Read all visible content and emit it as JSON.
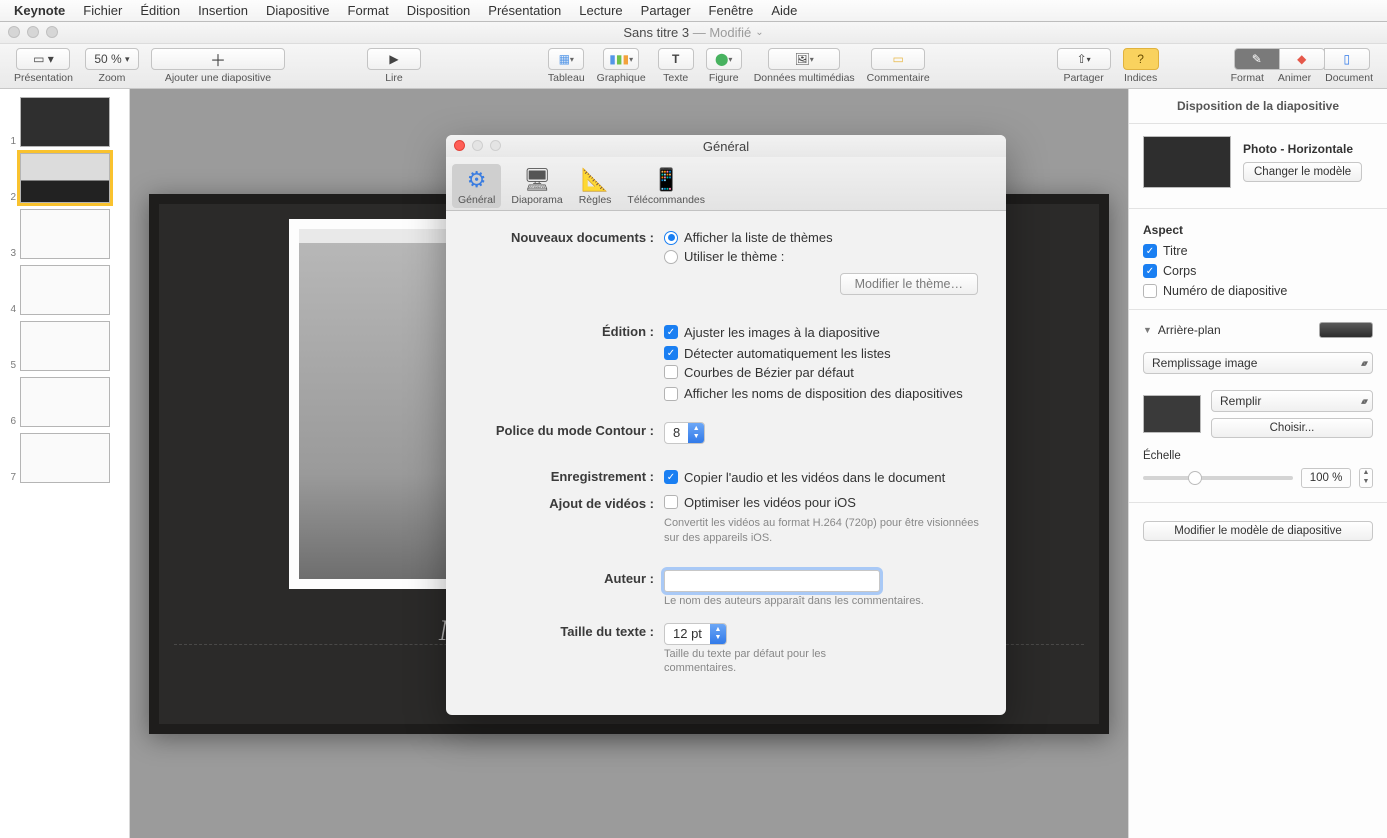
{
  "menubar": {
    "app": "Keynote",
    "items": [
      "Fichier",
      "Édition",
      "Insertion",
      "Diapositive",
      "Format",
      "Disposition",
      "Présentation",
      "Lecture",
      "Partager",
      "Fenêtre",
      "Aide"
    ]
  },
  "titlebar": {
    "title": "Sans titre 3",
    "modified": "— Modifié"
  },
  "toolbar": {
    "presentation": "Présentation",
    "zoom_value": "50 %",
    "zoom": "Zoom",
    "add_slide": "Ajouter une diapositive",
    "play": "Lire",
    "table": "Tableau",
    "chart": "Graphique",
    "text": "Texte",
    "shape": "Figure",
    "media": "Données multimédias",
    "comment": "Commentaire",
    "share": "Partager",
    "tips": "Indices",
    "format": "Format",
    "animate": "Animer",
    "document": "Document"
  },
  "slide_nav": {
    "slides": [
      1,
      2,
      3,
      4,
      5,
      6,
      7
    ],
    "selected": 2
  },
  "slide": {
    "caption": "M"
  },
  "inspector": {
    "title": "Disposition de la diapositive",
    "layout_name": "Photo - Horizontale",
    "change_model": "Changer le modèle",
    "aspect": "Aspect",
    "titre": "Titre",
    "corps": "Corps",
    "slide_number": "Numéro de diapositive",
    "background": "Arrière-plan",
    "fill_type": "Remplissage image",
    "scale_mode": "Remplir",
    "choose": "Choisir...",
    "scale": "Échelle",
    "scale_value": "100 %",
    "edit_model": "Modifier le modèle de diapositive"
  },
  "dialog": {
    "title": "Général",
    "tabs": {
      "general": "Général",
      "slideshow": "Diaporama",
      "rulers": "Règles",
      "remotes": "Télécommandes"
    },
    "new_docs": {
      "label": "Nouveaux documents :",
      "show_theme_list": "Afficher la liste de thèmes",
      "use_theme": "Utiliser le thème :",
      "modify_theme": "Modifier le thème…"
    },
    "editing": {
      "label": "Édition :",
      "fit_images": "Ajuster les images à la diapositive",
      "detect_lists": "Détecter automatiquement les listes",
      "bezier": "Courbes de Bézier par défaut",
      "show_layout_names": "Afficher les noms de disposition des diapositives"
    },
    "outline_font": {
      "label": "Police du mode Contour :",
      "value": "8"
    },
    "recording": {
      "label": "Enregistrement :",
      "copy_av": "Copier l'audio et les vidéos dans le document"
    },
    "adding_videos": {
      "label": "Ajout de vidéos :",
      "optimize": "Optimiser les vidéos pour iOS",
      "help": "Convertit les vidéos au format H.264 (720p) pour être visionnées sur des appareils iOS."
    },
    "author": {
      "label": "Auteur :",
      "value": "",
      "help": "Le nom des auteurs apparaît dans les commentaires."
    },
    "text_size": {
      "label": "Taille du texte :",
      "value": "12 pt",
      "help": "Taille du texte par défaut pour les commentaires."
    }
  }
}
